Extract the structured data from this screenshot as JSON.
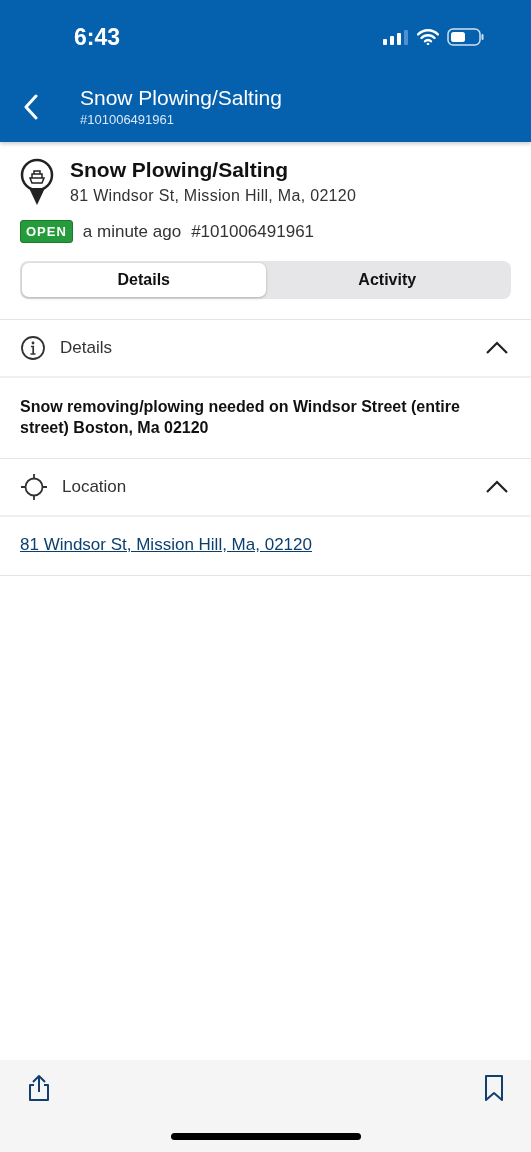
{
  "status_bar": {
    "time": "6:43"
  },
  "header": {
    "title": "Snow Plowing/Salting",
    "subtitle": "#101006491961"
  },
  "request": {
    "title": "Snow Plowing/Salting",
    "address": "81 Windsor St, Mission Hill, Ma, 02120",
    "status": "OPEN",
    "time": "a minute ago",
    "number": "#101006491961"
  },
  "tabs": [
    {
      "label": "Details",
      "selected": true
    },
    {
      "label": "Activity",
      "selected": false
    }
  ],
  "sections": [
    {
      "kind": "info",
      "title": "Details",
      "expanded": true,
      "text": "Snow removing/plowing needed on Windsor Street (entire street) Boston, Ma 02120"
    },
    {
      "kind": "location",
      "title": "Location",
      "expanded": true,
      "link": "81 Windsor St, Mission Hill, Ma, 02120"
    }
  ]
}
